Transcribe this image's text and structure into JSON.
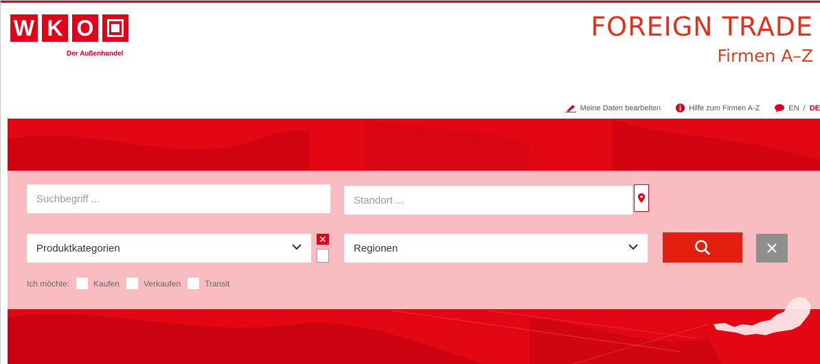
{
  "brand": {
    "letters": [
      "W",
      "K",
      "O"
    ],
    "tagline": "Der Außenhandel"
  },
  "header": {
    "title": "FOREIGN TRADE",
    "subtitle": "Firmen A–Z"
  },
  "toplinks": {
    "edit_data": "Meine Daten bearbeiten",
    "help": "Hilfe zum Firmen A-Z",
    "lang_en": "EN",
    "lang_sep": "/",
    "lang_de": "DE"
  },
  "search": {
    "term_placeholder": "Suchbegriff ...",
    "location_placeholder": "Standort ...",
    "category_value": "Produktkategorien",
    "region_value": "Regionen"
  },
  "options": {
    "label": "Ich möchte:",
    "buy": "Kaufen",
    "sell": "Verkaufen",
    "transit": "Transit"
  },
  "colors": {
    "brand_red": "#e2001a",
    "banner_red": "#e30613",
    "reset_grey": "#8f8f8f"
  },
  "icons": {
    "edit": "pencil-icon",
    "help": "info-icon",
    "lang": "speech-bubble-icon",
    "location": "map-pin-icon",
    "search": "magnifier-icon",
    "reset": "close-icon",
    "dropdown": "chevron-down-icon"
  }
}
